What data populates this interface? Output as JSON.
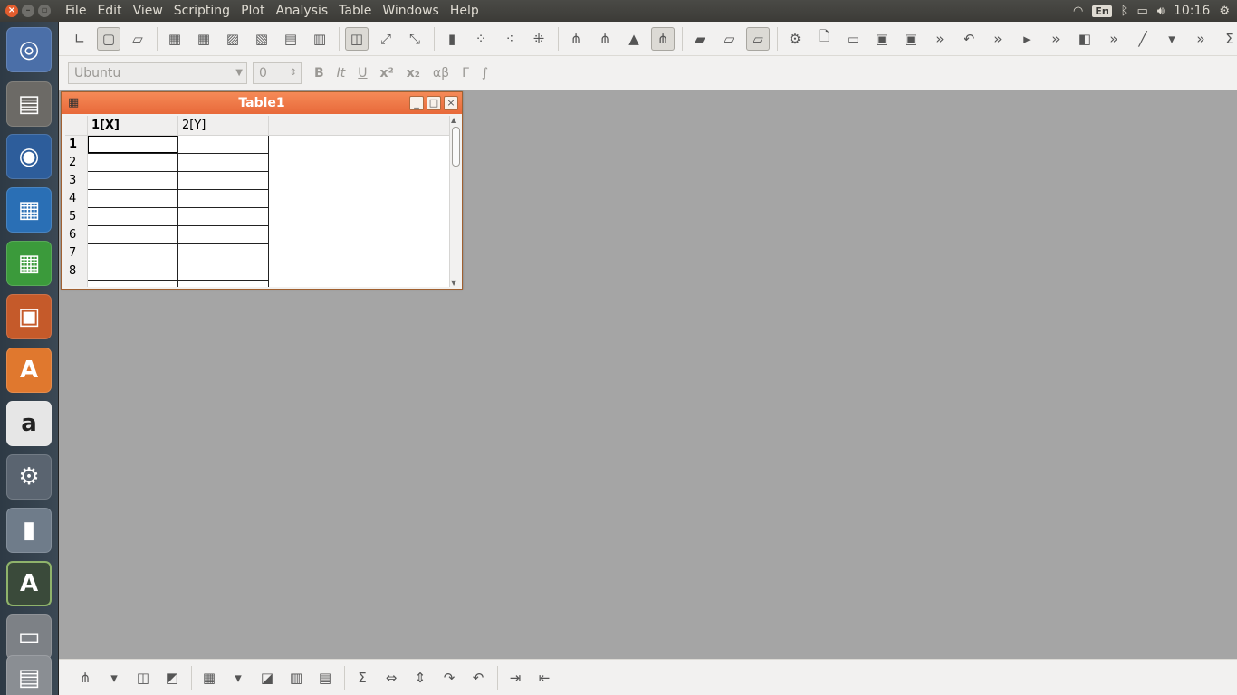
{
  "topbar": {
    "menus": [
      "File",
      "Edit",
      "View",
      "Scripting",
      "Plot",
      "Analysis",
      "Table",
      "Windows",
      "Help"
    ],
    "keyboard_layout": "En",
    "clock": "10:16"
  },
  "toolbar2": {
    "font": "Ubuntu",
    "font_size": "0",
    "bold": "B",
    "italic": "It",
    "underline": "U",
    "superscript": "x²",
    "subscript": "x₂",
    "greek": "αβ",
    "gamma": "Γ",
    "integral": "∫"
  },
  "table_window": {
    "title": "Table1",
    "columns": [
      "1[X]",
      "2[Y]"
    ],
    "rows": [
      "1",
      "2",
      "3",
      "4",
      "5",
      "6",
      "7",
      "8"
    ],
    "accent_color": "#f07746"
  }
}
